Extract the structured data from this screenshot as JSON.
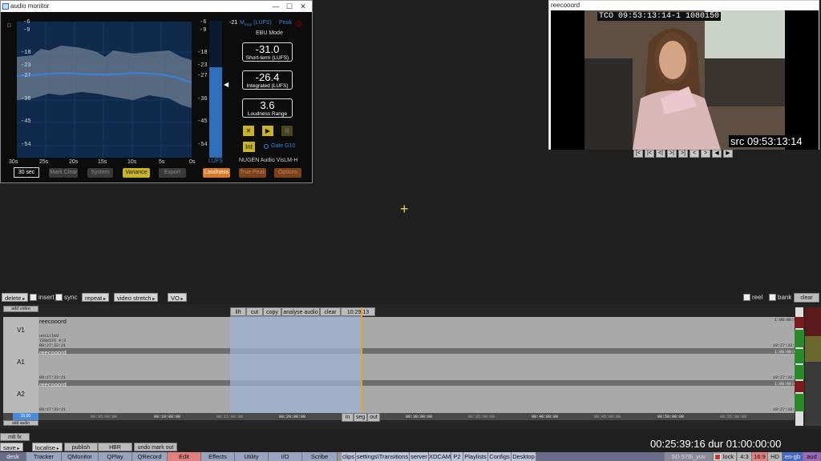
{
  "audio_monitor": {
    "title": "audio monitor",
    "db_scale_left": [
      "-6",
      "-9",
      "-18",
      "-23",
      "-27",
      "-36",
      "-45",
      "-54"
    ],
    "db_scale_right": [
      "-6",
      "-9",
      "-18",
      "-23",
      "-27",
      "-36",
      "-45",
      "-54"
    ],
    "time_labels": [
      "30s",
      "25s",
      "20s",
      "15s",
      "10s",
      "5s",
      "0s"
    ],
    "lufs_label": "LUFS",
    "meter_top_label": "-21",
    "mmax_label": "M",
    "mmax_sub": "max",
    "mmax_unit": "(LUFS)",
    "peak_label": "Peak",
    "mode_label": "EBU Mode",
    "short_term_value": "-31.0",
    "short_term_label": "Short-term (LUFS)",
    "integrated_value": "-26.4",
    "integrated_label": "Integrated (LUFS)",
    "range_value": "3.6",
    "range_label": "Loudness Range",
    "int_label": "Int",
    "gate_label": "Gate G10",
    "brand": "NUGEN Audio VisLM-H",
    "duration_field": "30 sec",
    "btn_mark": "Mark",
    "btn_clear": "Clear",
    "btn_system": "System",
    "btn_variance": "Variance",
    "btn_export": "Export",
    "btn_loudness": "Loudness",
    "btn_truepeak": "True Peak",
    "btn_options": "Options",
    "meter_level": 0.66,
    "d_letter": "D",
    "stop_glyph": "✕",
    "play_glyph": "▶",
    "pause_glyph": "II",
    "pointer_glyph": "◀"
  },
  "viewer": {
    "name": "reecooord",
    "burnin_tc": "TCO 09:53:13:14-1 1080i50",
    "src_tc": "src 09:53:13:14",
    "nav_buttons": [
      "[<",
      "|<",
      "<|",
      ">|",
      ">]",
      "<",
      ">",
      "◀",
      "▶"
    ]
  },
  "toolbar": {
    "delete": "delete",
    "insert": "insert",
    "sync": "sync",
    "repeat": "repeat",
    "video_stretch": "video stretch",
    "vo": "VO",
    "reel": "reel",
    "bank": "bank",
    "clear": "clear"
  },
  "timeline": {
    "add_video": "add video",
    "add_audio": "add audio",
    "mark_menu": [
      "lift",
      "cut",
      "copy",
      "analyse audio",
      "clear"
    ],
    "mark_tc": "10:29:13",
    "tracks": [
      {
        "id": "V1",
        "clip": "reecooord",
        "meta1": "untitled",
        "meta2": "720x576 4:3",
        "meta3": "09:27:33:21",
        "end_tc": "1:00:00:00",
        "tc_r": "10:27:33:22"
      },
      {
        "id": "A1",
        "clip": "reecooord",
        "meta1": "",
        "meta2": "",
        "meta3": "09:27:33:21",
        "end_tc": "1:00:00:00",
        "tc_r": "10:27:33:22"
      },
      {
        "id": "A2",
        "clip": "reecooord",
        "meta1": "",
        "meta2": "",
        "meta3": "09:27:33:21",
        "end_tc": "1:00:00:00",
        "tc_r": "10:27:33:22"
      }
    ],
    "ruler": [
      "00:05:00:00",
      "00:10:00:00",
      "00:15:00:00",
      "00:20:00:00",
      "00:25:00:00",
      "00:30:00:00",
      "00:35:00:00",
      "00:40:00:00",
      "00:45:00:00",
      "00:50:00:00",
      "00:55:00:00"
    ],
    "zoom": "25.00",
    "in": "in",
    "seg": "seg",
    "out": "out"
  },
  "footer": {
    "mlt_fx": "mlt fx",
    "save": "save",
    "localise": "localise",
    "publish": "publish",
    "hbr": "HBR",
    "undo": "undo mark out",
    "timecode": "00:25:39:16 dur 01:00:00:00",
    "tabs": [
      "desk",
      "Tracker",
      "QMonitor",
      "QPlay",
      "QRecord",
      "Edit",
      "Effects",
      "Utility",
      "I/O",
      "Scribe"
    ],
    "tabs2": [
      "clips",
      "settings\\Transitions",
      "server",
      "XDCAM",
      "P2",
      "Playlists",
      "Configs",
      "Desktop"
    ],
    "format": "SD 576i_yuv",
    "lock": "lock",
    "ar43": "4:3",
    "ar169": "16:9",
    "hd": "HD",
    "lang": "en-gb",
    "aud": "aud"
  },
  "win_controls": {
    "min": "—",
    "max": "☐",
    "close": "✕"
  },
  "crosshair_glyph": "+",
  "colors": {
    "accent_yellow": "#c9b32a",
    "accent_orange": "#d87a2c",
    "playhead": "#e8a030",
    "selection": "#9fb3d3"
  }
}
